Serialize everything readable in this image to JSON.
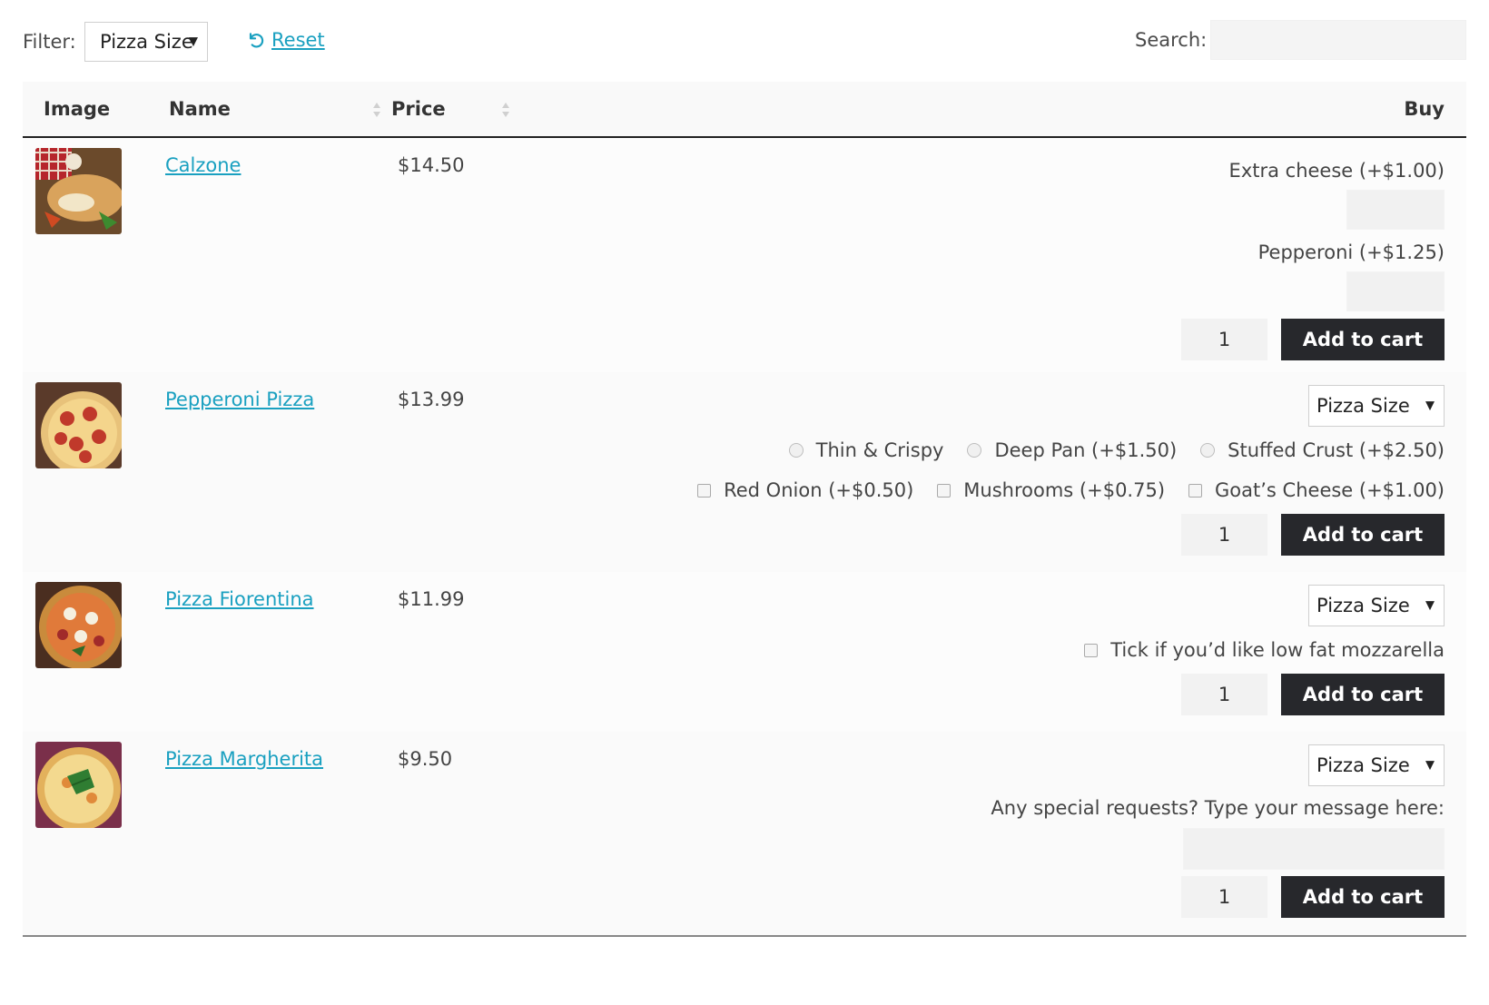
{
  "filter": {
    "label": "Filter:",
    "selected": "Pizza Size"
  },
  "reset": {
    "label": "Reset"
  },
  "search": {
    "label": "Search:",
    "value": ""
  },
  "table": {
    "headers": {
      "image": "Image",
      "name": "Name",
      "price": "Price",
      "buy": "Buy"
    }
  },
  "products": [
    {
      "name": "Calzone",
      "price": "$14.50",
      "options": [
        {
          "label": "Extra cheese (+$1.00)",
          "value": ""
        },
        {
          "label": "Pepperoni (+$1.25)",
          "value": ""
        }
      ],
      "quantity": "1",
      "cart_label": "Add to cart"
    },
    {
      "name": "Pepperoni Pizza",
      "price": "$13.99",
      "size_select": "Pizza Size",
      "radios": [
        "Thin & Crispy",
        "Deep Pan (+$1.50)",
        "Stuffed Crust (+$2.50)"
      ],
      "checkboxes": [
        "Red Onion (+$0.50)",
        "Mushrooms (+$0.75)",
        "Goat’s Cheese (+$1.00)"
      ],
      "quantity": "1",
      "cart_label": "Add to cart"
    },
    {
      "name": "Pizza Fiorentina",
      "price": "$11.99",
      "size_select": "Pizza Size",
      "checkbox": "Tick if you’d like low fat mozzarella",
      "quantity": "1",
      "cart_label": "Add to cart"
    },
    {
      "name": "Pizza Margherita",
      "price": "$9.50",
      "size_select": "Pizza Size",
      "message_label": "Any special requests? Type your message here:",
      "message_value": "",
      "quantity": "1",
      "cart_label": "Add to cart"
    }
  ],
  "colors": {
    "link": "#1aa0c0",
    "button": "#27282c",
    "input": "#f2f2f2"
  },
  "icons": {
    "reset": "undo-icon",
    "sort": "sort-arrows-icon",
    "dropdown": "caret-down-icon"
  }
}
